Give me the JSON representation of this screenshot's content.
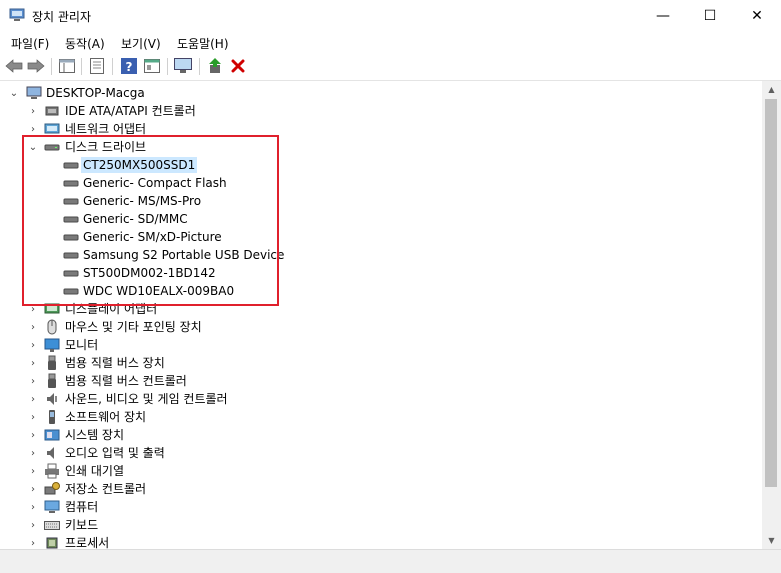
{
  "window": {
    "title": "장치 관리자",
    "minimize_glyph": "—",
    "maximize_glyph": "☐",
    "close_glyph": "✕"
  },
  "menu": [
    "파일(F)",
    "동작(A)",
    "보기(V)",
    "도움말(H)"
  ],
  "toolbar": [
    "back-icon",
    "forward-icon",
    "show-hide-tree-icon",
    "properties-icon",
    "help-icon",
    "view-icon",
    "monitor-scan-icon",
    "update-driver-icon",
    "uninstall-icon"
  ],
  "tree": {
    "root": "DESKTOP-Macga",
    "items": [
      {
        "label": "IDE ATA/ATAPI 컨트롤러",
        "icon": "ide-controller-icon",
        "state": "collapsed"
      },
      {
        "label": "네트워크 어댑터",
        "icon": "network-adapter-icon",
        "state": "collapsed"
      },
      {
        "label": "디스크 드라이브",
        "icon": "disk-drive-icon",
        "state": "expanded",
        "children": [
          "CT250MX500SSD1",
          "Generic- Compact Flash",
          "Generic- MS/MS-Pro",
          "Generic- SD/MMC",
          "Generic- SM/xD-Picture",
          "Samsung S2 Portable USB Device",
          "ST500DM002-1BD142",
          "WDC WD10EALX-009BA0"
        ]
      },
      {
        "label": "디스플레이 어댑터",
        "icon": "display-adapter-icon",
        "state": "collapsed"
      },
      {
        "label": "마우스 및 기타 포인팅 장치",
        "icon": "mouse-icon",
        "state": "collapsed"
      },
      {
        "label": "모니터",
        "icon": "monitor-icon",
        "state": "collapsed"
      },
      {
        "label": "범용 직렬 버스 장치",
        "icon": "usb-device-icon",
        "state": "collapsed"
      },
      {
        "label": "범용 직렬 버스 컨트롤러",
        "icon": "usb-controller-icon",
        "state": "collapsed"
      },
      {
        "label": "사운드, 비디오 및 게임 컨트롤러",
        "icon": "sound-icon",
        "state": "collapsed"
      },
      {
        "label": "소프트웨어 장치",
        "icon": "software-device-icon",
        "state": "collapsed"
      },
      {
        "label": "시스템 장치",
        "icon": "system-device-icon",
        "state": "collapsed"
      },
      {
        "label": "오디오 입력 및 출력",
        "icon": "audio-io-icon",
        "state": "collapsed"
      },
      {
        "label": "인쇄 대기열",
        "icon": "print-queue-icon",
        "state": "collapsed"
      },
      {
        "label": "저장소 컨트롤러",
        "icon": "storage-controller-icon",
        "state": "collapsed"
      },
      {
        "label": "컴퓨터",
        "icon": "computer-icon",
        "state": "collapsed"
      },
      {
        "label": "키보드",
        "icon": "keyboard-icon",
        "state": "collapsed"
      },
      {
        "label": "프로세서",
        "icon": "processor-icon",
        "state": "collapsed"
      }
    ]
  },
  "selected_item": "CT250MX500SSD1",
  "colors": {
    "selection": "#cce8ff",
    "highlight_box": "#e0202c",
    "uninstall": "#d00000"
  }
}
